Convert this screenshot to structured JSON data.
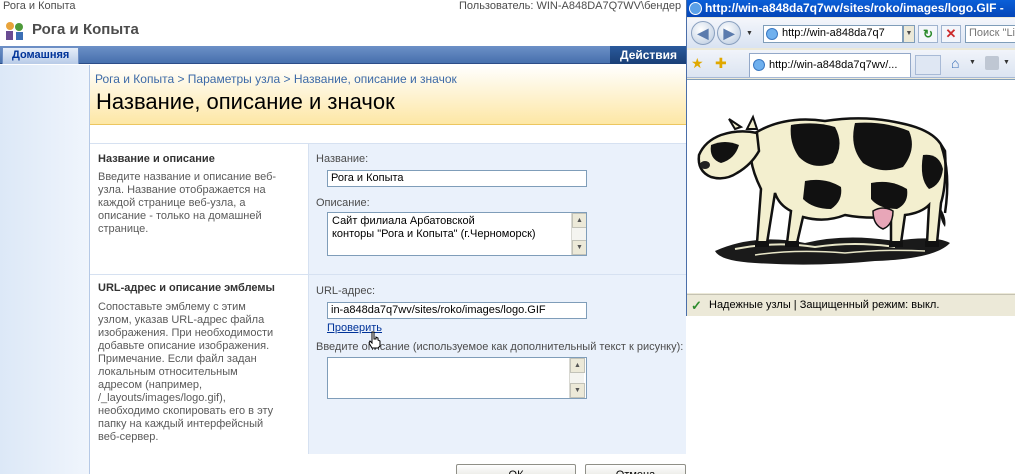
{
  "sharepoint": {
    "site_crumb": "Рога и Копыта",
    "user_label": "Пользователь: WIN-A848DA7Q7WV\\бендер",
    "site_title": "Рога и Копыта",
    "tabs": {
      "home": "Домашняя"
    },
    "actions_label": "Действия",
    "breadcrumb": "Рога и Копыта > Параметры узла > Название, описание и значок",
    "page_title": "Название, описание и значок",
    "sections": {
      "name_desc": {
        "heading": "Название и описание",
        "help": "Введите название и описание веб-узла. Название отображается на каждой странице веб-узла, а описание - только на домашней странице.",
        "name_label": "Название:",
        "name_value": "Рога и Копыта",
        "desc_label": "Описание:",
        "desc_line1": "Сайт филиала Арбатовской",
        "desc_line2": "конторы \"Рога и Копыта\" (г.Черноморск)"
      },
      "logo": {
        "heading": "URL-адрес и описание эмблемы",
        "help": "Сопоставьте эмблему с этим узлом, указав URL-адрес файла изображения. При необходимости добавьте описание изображения. Примечание. Если файл задан локальным относительным адресом (например, /_layouts/images/logo.gif), необходимо скопировать его в эту папку на каждый интерфейсный веб-сервер.",
        "url_label": "URL-адрес:",
        "url_value": "in-a848da7q7wv/sites/roko/images/logo.GIF",
        "verify_link": "Проверить",
        "alt_label": "Введите описание (используемое как дополнительный текст к рисунку):",
        "alt_value": ""
      }
    },
    "buttons": {
      "ok": "ОК",
      "cancel": "Отмена"
    }
  },
  "ie": {
    "title": "http://win-a848da7q7wv/sites/roko/images/logo.GIF -",
    "address": "http://win-a848da7q7",
    "search_placeholder": "Поиск \"Live",
    "tab_title": "http://win-a848da7q7wv/...",
    "status_text": "Надежные узлы | Защищенный режим: выкл.",
    "image_icon": "cow-image"
  },
  "colors": {
    "tab_bar": "#4770ad",
    "header_gradient_end": "#fde7a5",
    "breadcrumb": "#3d6aa7",
    "link": "#003399",
    "ie_title": "#0546b8"
  }
}
